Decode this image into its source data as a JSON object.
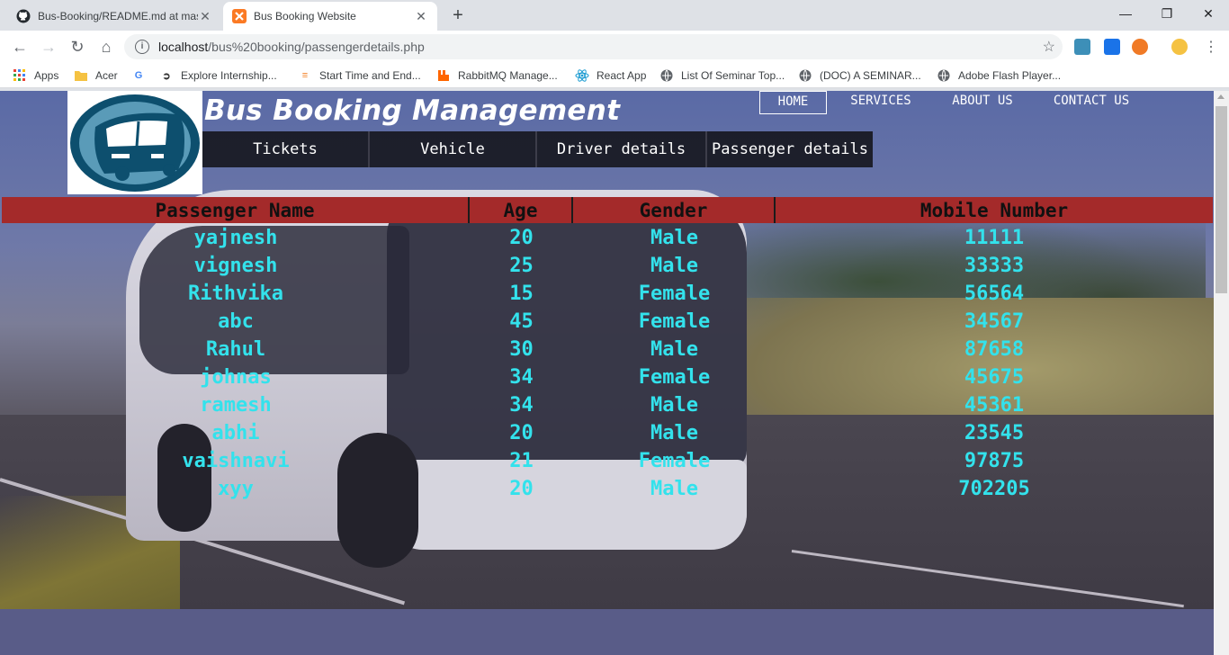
{
  "browser": {
    "tabs": [
      {
        "title": "Bus-Booking/README.md at mast",
        "icon": "github-icon",
        "active": false
      },
      {
        "title": "Bus Booking Website",
        "icon": "xampp-icon",
        "active": true
      }
    ],
    "new_tab": "+",
    "window_controls": {
      "minimize": "—",
      "restore": "❐",
      "close": "✕"
    },
    "url_host": "localhost",
    "url_path": "/bus%20booking/passengerdetails.php",
    "bookmarks": [
      {
        "label": "Apps",
        "icon": "apps-grid-icon"
      },
      {
        "label": "Acer",
        "icon": "folder-icon"
      },
      {
        "label": "",
        "icon": "google-icon"
      },
      {
        "label": "Explore Internship...",
        "icon": "internshala-icon"
      },
      {
        "label": "Start Time and End...",
        "icon": "stackoverflow-icon"
      },
      {
        "label": "RabbitMQ Manage...",
        "icon": "rabbitmq-icon"
      },
      {
        "label": "React App",
        "icon": "react-icon"
      },
      {
        "label": "List Of Seminar Top...",
        "icon": "globe-icon"
      },
      {
        "label": "(DOC) A SEMINAR...",
        "icon": "globe-icon"
      },
      {
        "label": "Adobe Flash Player...",
        "icon": "globe-icon"
      }
    ]
  },
  "site": {
    "title": "Bus Booking Management",
    "topnav": [
      "HOME",
      "SERVICES",
      "ABOUT US",
      "CONTACT US"
    ],
    "subnav": [
      "Tickets",
      "Vehicle",
      "Driver details",
      "Passenger details"
    ]
  },
  "table": {
    "headers": [
      "Passenger Name",
      "Age",
      "Gender",
      "Mobile Number"
    ],
    "rows": [
      [
        "yajnesh",
        "20",
        "Male",
        "11111"
      ],
      [
        "vignesh",
        "25",
        "Male",
        "33333"
      ],
      [
        "Rithvika",
        "15",
        "Female",
        "56564"
      ],
      [
        "abc",
        "45",
        "Female",
        "34567"
      ],
      [
        "Rahul",
        "30",
        "Male",
        "87658"
      ],
      [
        "johnas",
        "34",
        "Female",
        "45675"
      ],
      [
        "ramesh",
        "34",
        "Male",
        "45361"
      ],
      [
        "abhi",
        "20",
        "Male",
        "23545"
      ],
      [
        "vaishnavi",
        "21",
        "Female",
        "97875"
      ],
      [
        "xyy",
        "20",
        "Male",
        "702205"
      ]
    ]
  },
  "colors": {
    "header_bg": "#a42a2a",
    "cell_text": "#33e2ec"
  }
}
